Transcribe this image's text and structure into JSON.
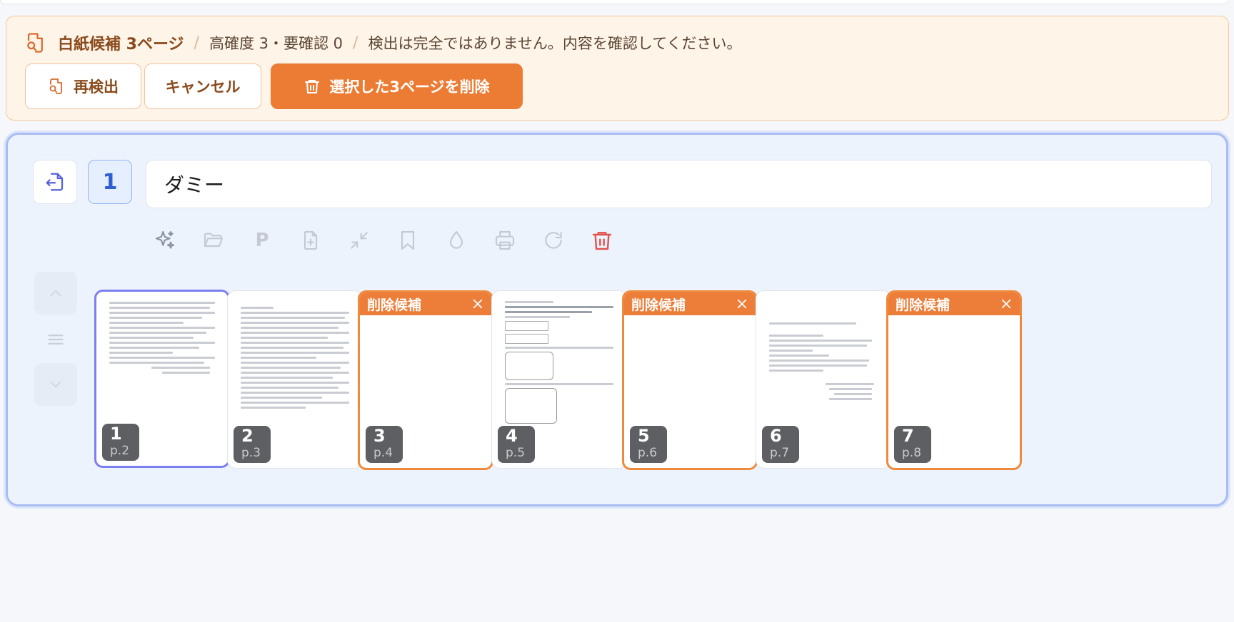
{
  "banner": {
    "title": "白紙候補 3ページ",
    "confidence": "高確度 3・要確認 0",
    "notice": "検出は完全ではありません。内容を確認してください。",
    "redetect_label": "再検出",
    "cancel_label": "キャンセル",
    "delete_label": "選択した3ページを削除"
  },
  "document": {
    "index": "1",
    "name": "ダミー"
  },
  "toolbar": {
    "tools": [
      "sparkle-icon",
      "folder-icon",
      "p-label",
      "file-plus-icon",
      "compress-icon",
      "bookmark-icon",
      "droplet-icon",
      "printer-icon",
      "rotate-icon",
      "trash-icon"
    ],
    "p_label": "P"
  },
  "candidate_label": "削除候補",
  "pages": [
    {
      "num": "1",
      "page": "p.2",
      "state": "selected"
    },
    {
      "num": "2",
      "page": "p.3",
      "state": "normal"
    },
    {
      "num": "3",
      "page": "p.4",
      "state": "candidate"
    },
    {
      "num": "4",
      "page": "p.5",
      "state": "normal"
    },
    {
      "num": "5",
      "page": "p.6",
      "state": "candidate"
    },
    {
      "num": "6",
      "page": "p.7",
      "state": "normal"
    },
    {
      "num": "7",
      "page": "p.8",
      "state": "candidate"
    }
  ],
  "colors": {
    "accent_orange": "#ec7c34",
    "selected_border": "#7b7ff0",
    "card_border": "#a9bdf0",
    "trash_red": "#e2524f"
  }
}
